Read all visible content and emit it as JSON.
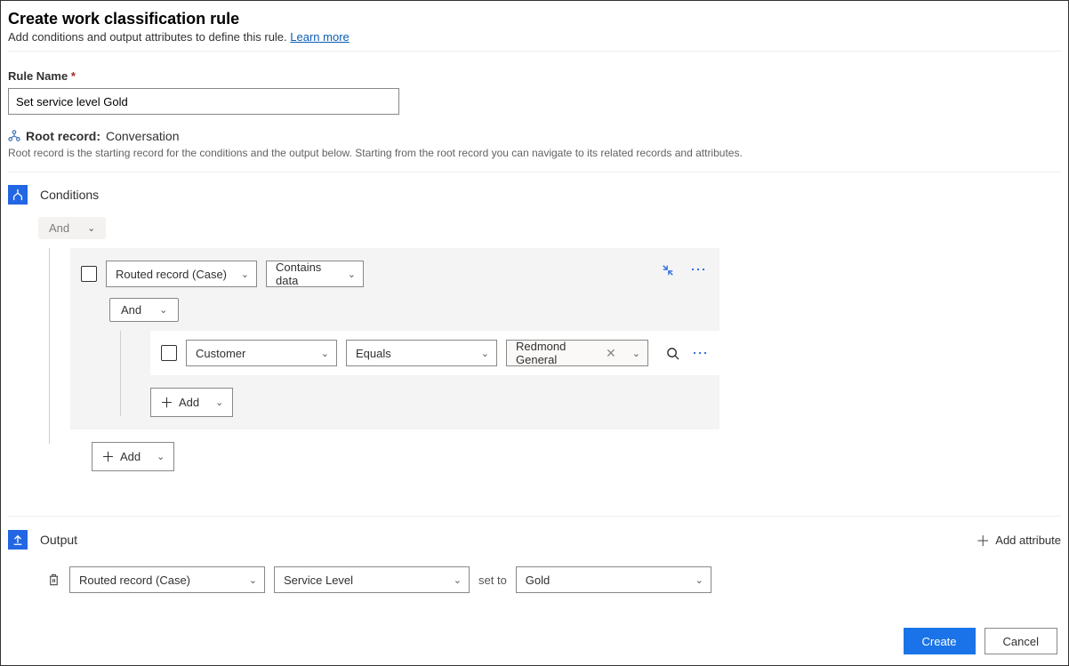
{
  "header": {
    "title": "Create work classification rule",
    "subtitle": "Add conditions and output attributes to define this rule.",
    "learn_more": "Learn more"
  },
  "rule_name": {
    "label": "Rule Name",
    "value": "Set service level Gold"
  },
  "root_record": {
    "label": "Root record:",
    "value": "Conversation",
    "description": "Root record is the starting record for the conditions and the output below. Starting from the root record you can navigate to its related records and attributes."
  },
  "conditions": {
    "title": "Conditions",
    "top_operator": "And",
    "group1": {
      "field": "Routed record (Case)",
      "operator": "Contains data",
      "inner_operator": "And",
      "nested": {
        "field": "Customer",
        "operator": "Equals",
        "value": "Redmond General"
      },
      "add_label": "Add"
    },
    "add_label": "Add"
  },
  "output": {
    "title": "Output",
    "add_attribute": "Add attribute",
    "row": {
      "entity": "Routed record (Case)",
      "field": "Service Level",
      "set_to": "set to",
      "value": "Gold"
    }
  },
  "footer": {
    "create": "Create",
    "cancel": "Cancel"
  }
}
